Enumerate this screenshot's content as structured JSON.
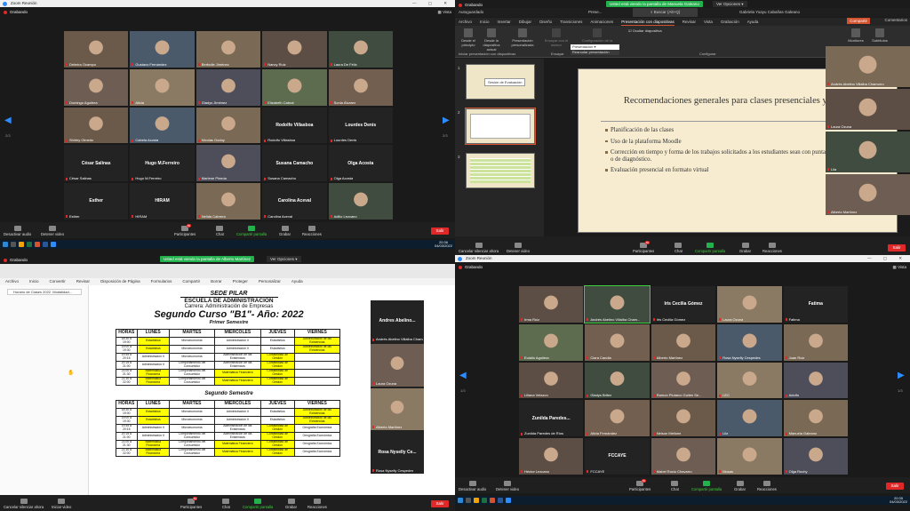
{
  "tl": {
    "window_title": "Zoom Reunión",
    "recording": "Grabando",
    "view": "Vista",
    "page_left": "2/3",
    "page_right": "2/3",
    "tiles": [
      {
        "name": "Delmira Ocampo",
        "big": ""
      },
      {
        "name": "Gustavo Fernández",
        "big": ""
      },
      {
        "name": "Berfodie Jiménez",
        "big": ""
      },
      {
        "name": "Nancy Ruiz",
        "big": ""
      },
      {
        "name": "Laura De Félix",
        "big": ""
      },
      {
        "name": "Domingo Aguilera",
        "big": ""
      },
      {
        "name": "Alicia",
        "big": ""
      },
      {
        "name": "Gladys Jiménez",
        "big": ""
      },
      {
        "name": "Elizabeth Cabral",
        "big": ""
      },
      {
        "name": "Sonia Álvarez",
        "big": ""
      },
      {
        "name": "Shirley Olmedo",
        "big": ""
      },
      {
        "name": "Cabela Acosta",
        "big": ""
      },
      {
        "name": "Nicolas Godoy",
        "big": ""
      },
      {
        "name": "Rodolfo Villasboa",
        "big": "Rodolfo Villasboa"
      },
      {
        "name": "Lourdes Denis",
        "big": "Lourdes Denis"
      },
      {
        "name": "César Salinas",
        "big": "César Salinas"
      },
      {
        "name": "Hugo M.Ferreiro",
        "big": "Hugo M.Ferreiro"
      },
      {
        "name": "Marlene Pineda",
        "big": ""
      },
      {
        "name": "Susana Camacho",
        "big": "Susana Camacho"
      },
      {
        "name": "Olga Acosta",
        "big": "Olga Acosta"
      },
      {
        "name": "Esther",
        "big": "Esther"
      },
      {
        "name": "HIRAM",
        "big": "HIRAM"
      },
      {
        "name": "Nelida Cabrera",
        "big": ""
      },
      {
        "name": "Carolina Aceval",
        "big": "Carolina Aceval"
      },
      {
        "name": "Adilio Lezcano",
        "big": ""
      }
    ],
    "toolbar": {
      "audio": "Desactivar audio",
      "video": "Detener video",
      "participants": "Participantes",
      "participants_count": "55",
      "chat": "Chat",
      "share": "Compartir pantalla",
      "record": "Grabar",
      "reactions": "Reacciones",
      "leave": "Salir"
    },
    "clock": {
      "time": "20:36",
      "date": "04/03/2022"
    }
  },
  "tr": {
    "banner": "Usted está viendo la pantalla de Manuela Galeano",
    "options": "Ver Opciones",
    "recording": "Grabando",
    "autosave": "Autoguardado",
    "file": "Prese...",
    "search": "Buscar (Alt+Q)",
    "user": "Gabriela Yoayu Cabañas Galeano",
    "tabs": [
      "Archivo",
      "Inicio",
      "Insertar",
      "Dibujar",
      "Diseño",
      "Transiciones",
      "Animaciones",
      "Presentación con diapositivas",
      "Revisar",
      "Vista",
      "Grabación",
      "Ayuda"
    ],
    "active_tab": "Presentación con diapositivas",
    "share_btn": "Compartir",
    "comments_btn": "Comentarios",
    "ribbon": {
      "b1": "Desde el principio",
      "b2": "Desde la diapositiva actual",
      "b3": "Presentación personalizada",
      "b4": "Ensayar con el asesor",
      "b5": "Configuración de la",
      "hide": "Ocultar diapositiva",
      "group1": "Iniciar presentación con diapositivas",
      "group2": "Ensayar",
      "group3": "Configurar",
      "monitors": "Monitores",
      "subtitles": "Subtítulos",
      "presentation": "Presentación",
      "resume": "Reanudar presentación"
    },
    "thumb1": "Sesión de Evaluación",
    "slide": {
      "title": "Recomendaciones generales para clases presenciales y virtuales.",
      "bullets": [
        "Planificación de las clases",
        "Uso de la plataforma Moodle",
        "Corrección en tiempo y forma de los trabajos solicitados a los estudiantes sean con puntajes acumulativos, formativo o de diagnóstico.",
        "Evaluación presencial en formato virtual"
      ]
    },
    "side_tiles": [
      {
        "name": "Andrés Abelino Villalba Chamorro"
      },
      {
        "name": "Laura Ozuna"
      },
      {
        "name": "Lila"
      },
      {
        "name": "Alberto Martínez"
      }
    ],
    "toolbar": {
      "audio": "Cancelar silenciar ahora",
      "video": "Detener video",
      "participants": "Participantes",
      "participants_count": "56",
      "chat": "Chat",
      "share": "Compartir pantalla",
      "record": "Grabar",
      "reactions": "Reacciones",
      "leave": "Salir"
    }
  },
  "bl": {
    "recording": "Grabando",
    "banner": "Usted está viendo la pantalla de Alberto Martínez",
    "options": "Ver Opciones",
    "menu": [
      "Archivo",
      "Inicio",
      "Convertir",
      "Revisar",
      "Disposición de Página",
      "Formularios",
      "Compartir",
      "Borrar",
      "Proteger",
      "Personalizar",
      "Ayuda"
    ],
    "doc_tab": "Horario de Clases 2022. Modalidad...",
    "school": "SEDE PILAR",
    "escuela": "ESCUELA DE ADMINISTRACIÓN",
    "carrera": "Carrera: Administración de Empresas",
    "curso": "Segundo Curso \"B1\"- Año: 2022",
    "sem1": "Primer Semestre",
    "sem2": "Segundo Semestre",
    "headers": [
      "HORAS",
      "LUNES",
      "MARTES",
      "MIERCOLES",
      "JUEVES",
      "VIERNES"
    ],
    "rows1": [
      [
        "18:30 a 19:00",
        "Estadística",
        "Microeconomía",
        "Administración II",
        "Estadística",
        "Administración de las Existencias"
      ],
      [
        "19:00 a 19:30",
        "Estadística",
        "Microeconomía",
        "Administración II",
        "Estadística",
        "Administración de las Existencias"
      ],
      [
        "19:45 a 20:15",
        "Administración II",
        "Microeconomía",
        "Administración de las Existencias",
        "Contabilidad de Gestión",
        ""
      ],
      [
        "20:15 a 21:00",
        "Administración II",
        "Comportamiento del Consumidor",
        "Administración de las Existencias",
        "Contabilidad de Gestión",
        ""
      ],
      [
        "21:00 a 21:30",
        "Matemática Financiera",
        "Comportamiento del Consumidor",
        "Matemática Financiera",
        "Contabilidad de Gestión",
        ""
      ],
      [
        "21:30 a 22:00",
        "Matemática Financiera",
        "Comportamiento del Consumidor",
        "Matemática Financiera",
        "Contabilidad de Gestión",
        ""
      ]
    ],
    "rows2": [
      [
        "18:30 a 19:00",
        "Estadística",
        "Microeconomía",
        "Administración II",
        "Estadística",
        "Administración de las Existencias"
      ],
      [
        "19:00 a 19:30",
        "Estadística",
        "Microeconomía",
        "Administración II",
        "Estadística",
        "Administración de las Existencias"
      ],
      [
        "19:45 a 20:15",
        "Administración II",
        "Microeconomía",
        "Administración de las Existencias",
        "Contabilidad de Gestión",
        "Geografía Económica"
      ],
      [
        "20:15 a 21:00",
        "Administración II",
        "Comportamiento del Consumidor",
        "Administración de las Existencias",
        "Contabilidad de Gestión",
        "Geografía Económica"
      ],
      [
        "21:00 a 21:30",
        "Matemática Financiera",
        "Comportamiento del Consumidor",
        "Matemática Financiera",
        "Contabilidad de Gestión",
        "Geografía Económica"
      ],
      [
        "21:30 a 22:00",
        "Matemática Financiera",
        "Comportamiento del Consumidor",
        "Matemática Financiera",
        "Contabilidad de Gestión",
        "Geografía Económica"
      ]
    ],
    "side_tiles": [
      {
        "name": "Andrés Abelino Villalba Chamorro",
        "big": "Andres Abelino..."
      },
      {
        "name": "Laura Ozuna",
        "big": ""
      },
      {
        "name": "Alberto Martínez",
        "big": ""
      },
      {
        "name": "Rosa Nyselly Cespedes",
        "big": "Rosa Nyselly Ce..."
      }
    ],
    "toolbar": {
      "audio": "Cancelar silenciar ahora",
      "video": "Iniciar video",
      "participants": "Participantes",
      "participants_count": "51",
      "chat": "Chat",
      "share": "Compartir pantalla",
      "record": "Grabar",
      "reactions": "Reacciones",
      "leave": "Salir"
    }
  },
  "br": {
    "window_title": "Zoom Reunión",
    "recording": "Grabando",
    "view": "Vista",
    "page_left": "1/3",
    "page_right": "1/3",
    "tiles": [
      {
        "name": "Irma Ruiz",
        "big": ""
      },
      {
        "name": "Andrés Abelino Villalba Cham...",
        "big": ""
      },
      {
        "name": "Iris Cecilia Gómez",
        "big": "Iris Cecilia Gómez"
      },
      {
        "name": "Laura Ozuna",
        "big": ""
      },
      {
        "name": "Fatima",
        "big": "Fatima"
      },
      {
        "name": "Eulalio Aguilera",
        "big": ""
      },
      {
        "name": "Clara Candia",
        "big": ""
      },
      {
        "name": "Alberto Martínez",
        "big": ""
      },
      {
        "name": "Rosa Nyselly Cespedes",
        "big": ""
      },
      {
        "name": "Juan Ruiz",
        "big": ""
      },
      {
        "name": "Liliana Velazco",
        "big": ""
      },
      {
        "name": "Gladys Britez",
        "big": ""
      },
      {
        "name": "Ramon Plutarco Gullen Se...",
        "big": ""
      },
      {
        "name": "LEC",
        "big": ""
      },
      {
        "name": "Adolfo",
        "big": ""
      },
      {
        "name": "Zunilda Paredes de Ríos",
        "big": "Zunilda Paredes..."
      },
      {
        "name": "Alicia Fernández",
        "big": ""
      },
      {
        "name": "Nelson Mellone",
        "big": ""
      },
      {
        "name": "Lila",
        "big": ""
      },
      {
        "name": "Manuela Galeano",
        "big": ""
      },
      {
        "name": "Héctor Lezcano",
        "big": ""
      },
      {
        "name": "FCCAYE",
        "big": "FCCAYE"
      },
      {
        "name": "Mabel Rocio Chavarro",
        "big": ""
      },
      {
        "name": "Mosas",
        "big": ""
      },
      {
        "name": "Olga Ruchy",
        "big": ""
      }
    ],
    "toolbar": {
      "audio": "Desactivar audio",
      "video": "Detener video",
      "participants": "Participantes",
      "participants_count": "56",
      "chat": "Chat",
      "share": "Compartir pantalla",
      "record": "Grabar",
      "reactions": "Reacciones",
      "leave": "Salir"
    },
    "clock": {
      "time": "20:35",
      "date": "04/03/2022"
    }
  }
}
